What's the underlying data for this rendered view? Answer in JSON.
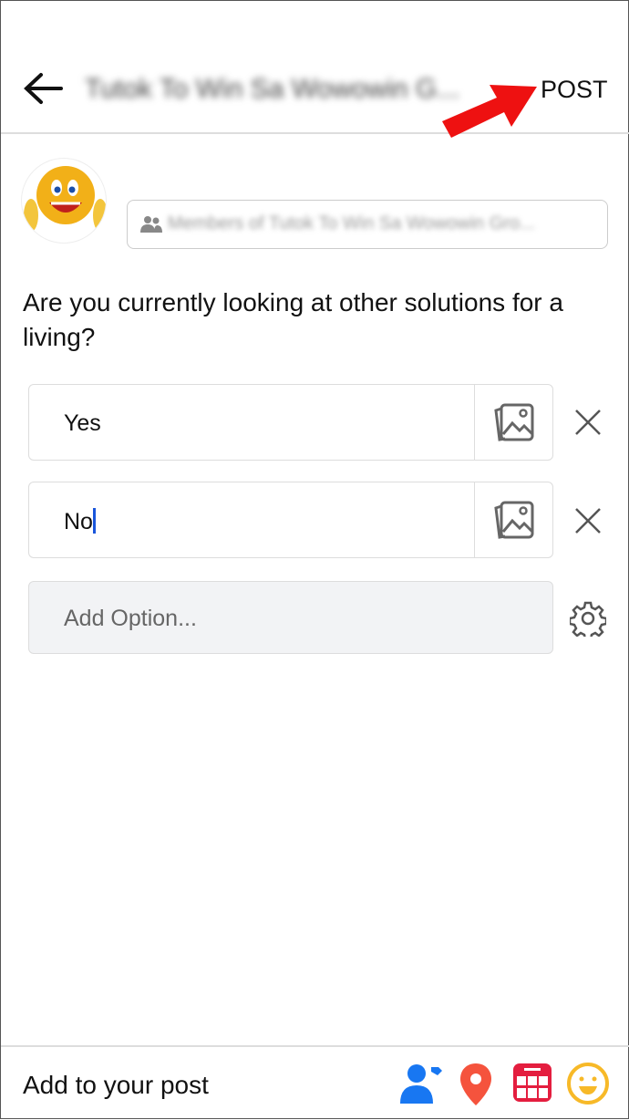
{
  "header": {
    "title": "Tutok To Win Sa Wowowin G...",
    "post_label": "POST"
  },
  "audience": {
    "label": "Members of Tutok To Win Sa Wowowin Gro..."
  },
  "poll": {
    "question": "Are you currently looking at other solutions for a living?",
    "options": [
      {
        "value": "Yes"
      },
      {
        "value": "No"
      }
    ],
    "add_placeholder": "Add Option..."
  },
  "footer": {
    "label": "Add to your post",
    "icons": [
      "tag-people-icon",
      "location-icon",
      "event-icon",
      "feeling-icon"
    ]
  },
  "colors": {
    "tag": "#1877f2",
    "location": "#f5533d",
    "event": "#e41e3f",
    "feeling": "#f7b928",
    "annotation_arrow": "#ee1111"
  }
}
